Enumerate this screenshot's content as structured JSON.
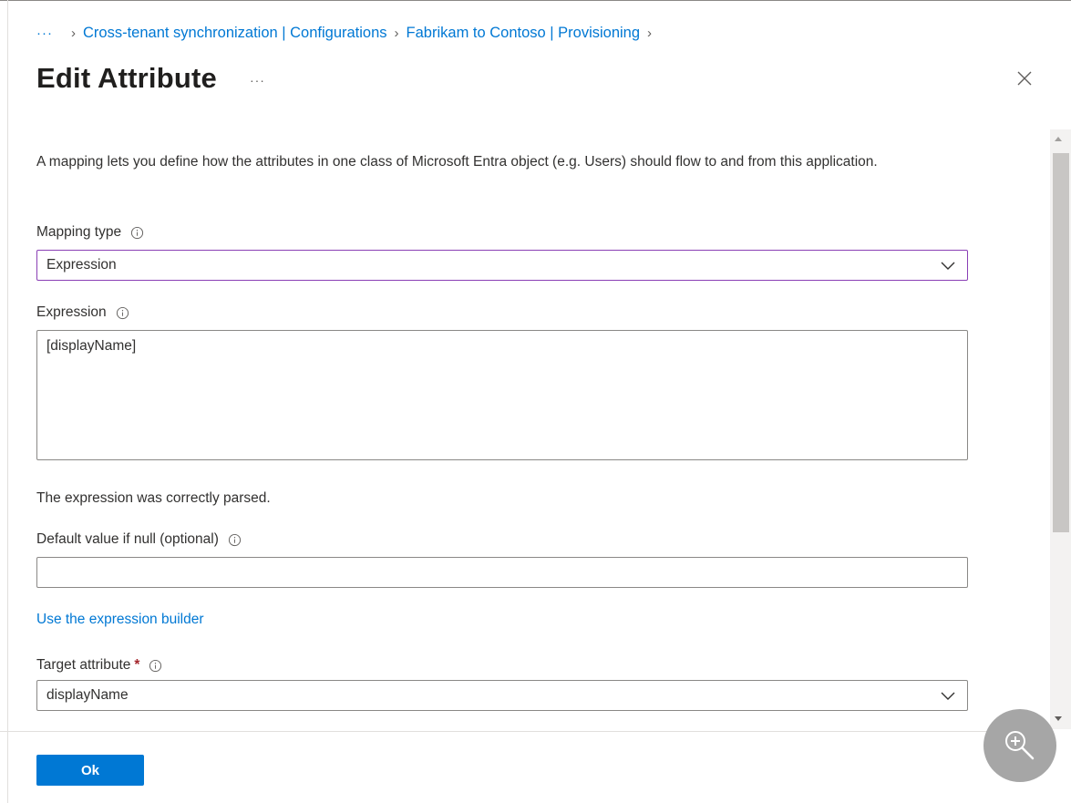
{
  "breadcrumb": {
    "more": "···",
    "items": [
      "Cross-tenant synchronization | Configurations",
      "Fabrikam to Contoso | Provisioning"
    ]
  },
  "header": {
    "title": "Edit Attribute",
    "more": "···"
  },
  "intro_text": "A mapping lets you define how the attributes in one class of Microsoft Entra object (e.g. Users) should flow to and from this application.",
  "mapping_type": {
    "label": "Mapping type",
    "value": "Expression"
  },
  "expression": {
    "label": "Expression",
    "value": "[displayName]",
    "status": "The expression was correctly parsed."
  },
  "default_value": {
    "label": "Default value if null (optional)",
    "value": ""
  },
  "builder_link": "Use the expression builder",
  "target_attribute": {
    "label": "Target attribute",
    "required_mark": "*",
    "value": "displayName"
  },
  "footer": {
    "ok_label": "Ok"
  },
  "colors": {
    "accent": "#0078d4",
    "focus_border": "#8a3fb5",
    "required": "#a4262c"
  }
}
